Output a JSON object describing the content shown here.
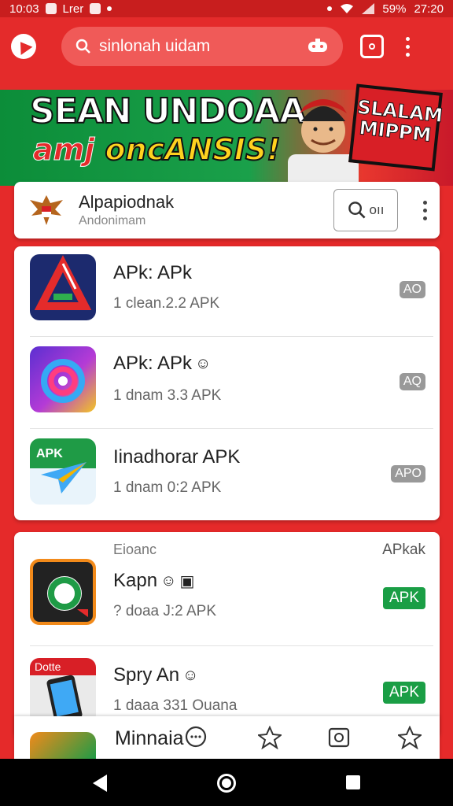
{
  "status_bar": {
    "time": "10:03",
    "carrier": "Lrer",
    "battery_text": "59%",
    "clock_right": "27:20"
  },
  "app_bar": {
    "search_query": "sinlonah uidam",
    "icons": [
      "app-logo-icon",
      "search-icon",
      "gamepad-icon",
      "square-camera-icon",
      "more-vert-icon"
    ]
  },
  "banner": {
    "line1": "SEAN UNDOAA",
    "line2_a": "amj ",
    "line2_b": "oncANSIS!",
    "sign_text": "SLALAM MIPPM"
  },
  "publisher": {
    "name": "Alpapiodnak",
    "subtitle": "Andonimam",
    "search_label": "oıı"
  },
  "list_top": [
    {
      "title": "APk: APk",
      "subtitle": "1 clean.2.2  APK",
      "badge": "AO",
      "icon": "red-triangle-app-icon"
    },
    {
      "title": "APk: APk",
      "subtitle": "1 dnam 3.3  APK",
      "badge": "AQ",
      "icon": "colorful-ring-app-icon"
    },
    {
      "title": "Iinadhorar APK",
      "subtitle": "1 dnam 0:2  APK",
      "badge": "APO",
      "icon": "paper-plane-app-icon"
    }
  ],
  "section": {
    "left": "Eioanc",
    "right": "APkak"
  },
  "list_bottom": [
    {
      "title": "Kapn",
      "subtitle": "? doaa J:2  APK",
      "badge": "APK",
      "icon": "green-circle-app-icon"
    },
    {
      "title": "Spry An",
      "subtitle": "1 daaa 331  Ouana",
      "badge": "APK",
      "icon": "phone-screenshot-app-icon",
      "icon_label": "Dotte"
    }
  ],
  "bottom_nav": {
    "label": "Minnaia",
    "icons": [
      "chat-icon",
      "star-icon",
      "camera-icon",
      "star-outline-icon"
    ]
  },
  "colors": {
    "primary": "#e42b2b",
    "green_badge": "#1a9e45",
    "grey_badge": "#999999"
  }
}
